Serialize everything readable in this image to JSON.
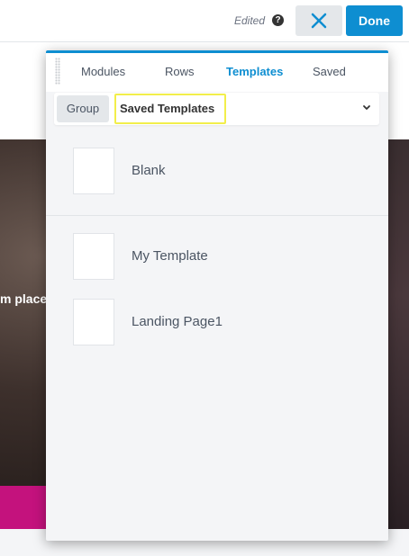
{
  "topbar": {
    "edited_label": "Edited",
    "help_icon": "?",
    "close_icon": "close-icon",
    "done_label": "Done",
    "accent_color": "#0e8ed1"
  },
  "background": {
    "hero_text": "m place"
  },
  "panel": {
    "tabs": [
      {
        "label": "Modules",
        "active": false
      },
      {
        "label": "Rows",
        "active": false
      },
      {
        "label": "Templates",
        "active": true
      },
      {
        "label": "Saved",
        "active": false
      }
    ],
    "group_label": "Group",
    "selected_group": "Saved Templates",
    "highlight_color": "#f2ee4b",
    "templates": [
      {
        "label": "Blank"
      },
      {
        "label": "My Template"
      },
      {
        "label": "Landing Page1"
      }
    ]
  }
}
